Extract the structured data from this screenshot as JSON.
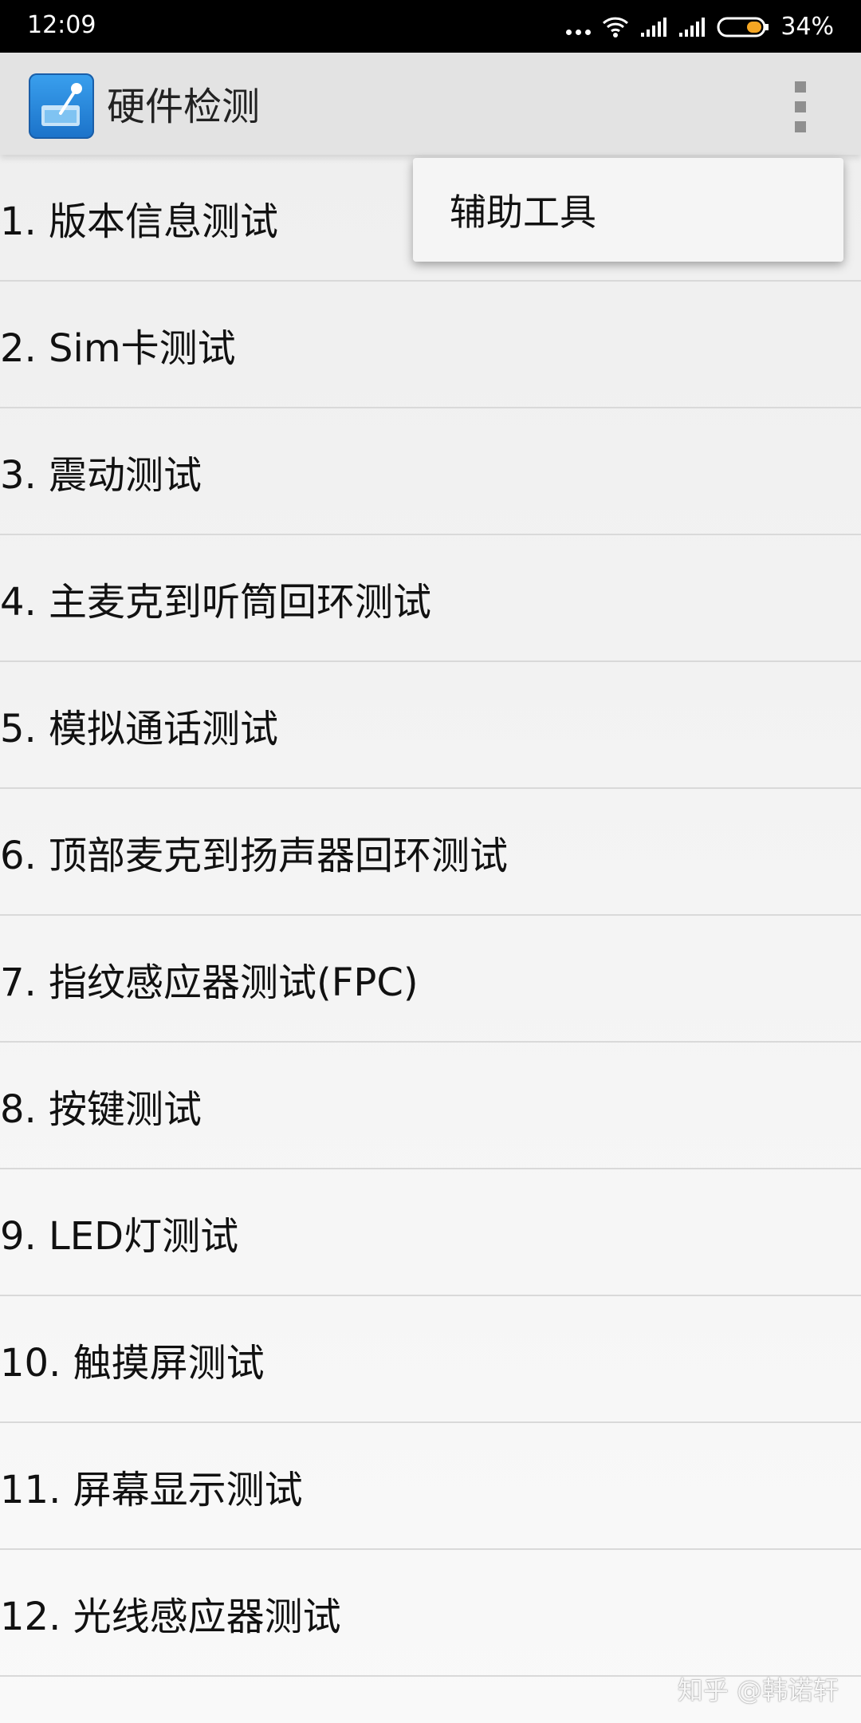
{
  "status_bar": {
    "time": "12:09",
    "battery_percent": "34%",
    "icons": [
      "more-dots-icon",
      "wifi-icon",
      "signal-icon",
      "signal-icon",
      "battery-icon"
    ]
  },
  "app_bar": {
    "title": "硬件检测",
    "icon": "hardware-test-app-icon",
    "overflow_icon": "overflow-menu-icon"
  },
  "popup_menu": {
    "items": [
      {
        "label": "辅助工具"
      }
    ]
  },
  "tests": [
    {
      "label": "1. 版本信息测试"
    },
    {
      "label": "2. Sim卡测试"
    },
    {
      "label": "3. 震动测试"
    },
    {
      "label": "4. 主麦克到听筒回环测试"
    },
    {
      "label": "5. 模拟通话测试"
    },
    {
      "label": "6. 顶部麦克到扬声器回环测试"
    },
    {
      "label": "7. 指纹感应器测试(FPC)"
    },
    {
      "label": "8. 按键测试"
    },
    {
      "label": "9. LED灯测试"
    },
    {
      "label": "10. 触摸屏测试"
    },
    {
      "label": "11. 屏幕显示测试"
    },
    {
      "label": "12. 光线感应器测试"
    }
  ],
  "watermark": "知乎 @韩诺轩",
  "colors": {
    "status_bar_bg": "#000000",
    "app_bar_bg": "#e3e3e3",
    "battery_fill": "#f5a623",
    "app_icon_blue": "#2a88dc"
  }
}
